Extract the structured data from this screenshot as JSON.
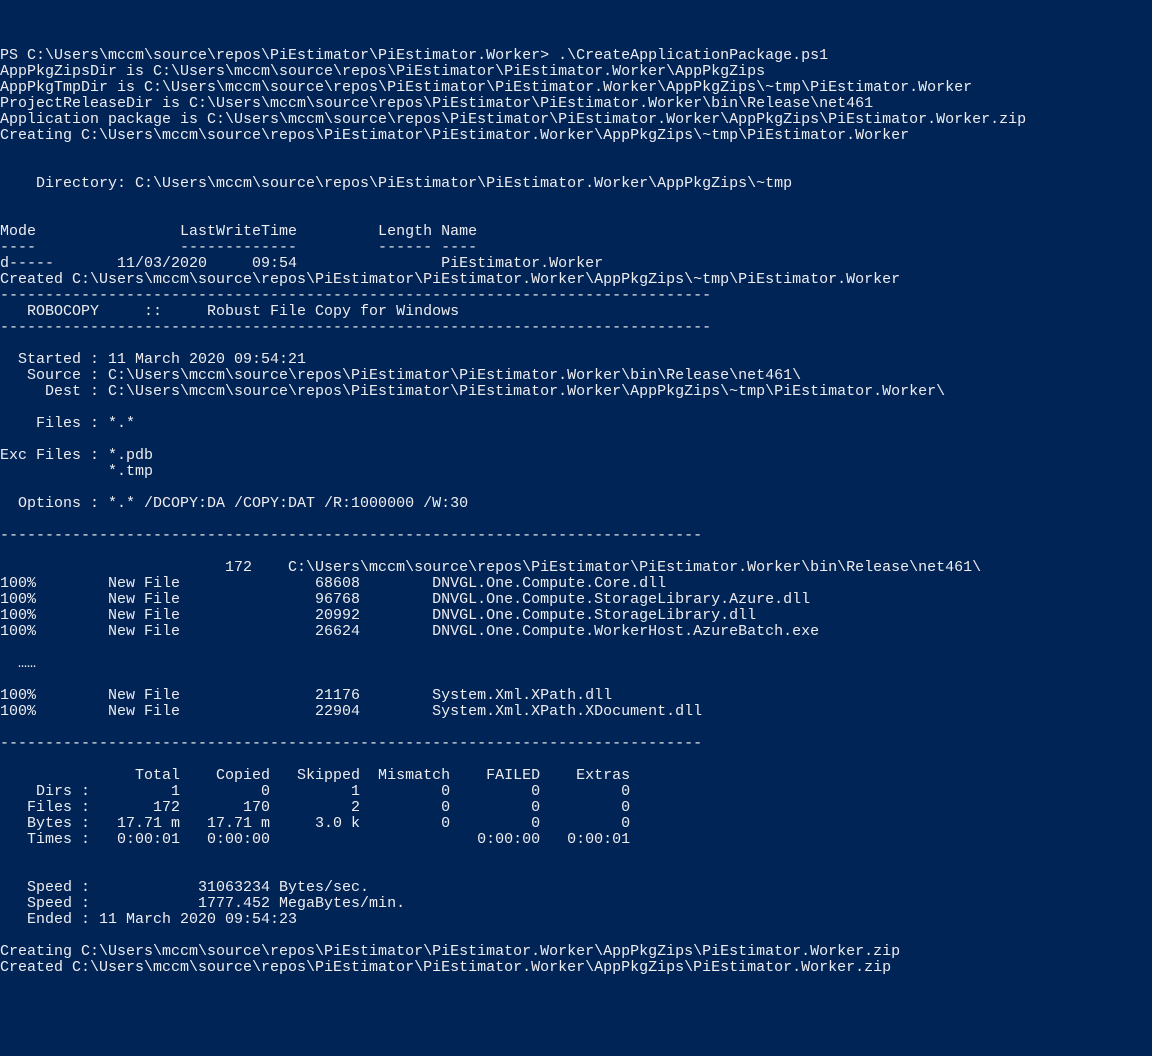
{
  "prompt": "PS C:\\Users\\mccm\\source\\repos\\PiEstimator\\PiEstimator.Worker> .\\CreateApplicationPackage.ps1",
  "vars": {
    "zipsDir": "AppPkgZipsDir is C:\\Users\\mccm\\source\\repos\\PiEstimator\\PiEstimator.Worker\\AppPkgZips",
    "tmpDir": "AppPkgTmpDir is C:\\Users\\mccm\\source\\repos\\PiEstimator\\PiEstimator.Worker\\AppPkgZips\\~tmp\\PiEstimator.Worker",
    "releaseDir": "ProjectReleaseDir is C:\\Users\\mccm\\source\\repos\\PiEstimator\\PiEstimator.Worker\\bin\\Release\\net461",
    "pkg": "Application package is C:\\Users\\mccm\\source\\repos\\PiEstimator\\PiEstimator.Worker\\AppPkgZips\\PiEstimator.Worker.zip"
  },
  "creating1": "Creating C:\\Users\\mccm\\source\\repos\\PiEstimator\\PiEstimator.Worker\\AppPkgZips\\~tmp\\PiEstimator.Worker",
  "dirHeader": "    Directory: C:\\Users\\mccm\\source\\repos\\PiEstimator\\PiEstimator.Worker\\AppPkgZips\\~tmp",
  "tableHeader": "Mode                LastWriteTime         Length Name",
  "tableDashes": "----                -------------         ------ ----",
  "tableRow": "d-----       11/03/2020     09:54                PiEstimator.Worker",
  "created1": "Created C:\\Users\\mccm\\source\\repos\\PiEstimator\\PiEstimator.Worker\\AppPkgZips\\~tmp\\PiEstimator.Worker",
  "sep": "-------------------------------------------------------------------------------",
  "robocopyTitle": "   ROBOCOPY     ::     Robust File Copy for Windows",
  "robocopy": {
    "started": "  Started : 11 March 2020 09:54:21",
    "source": "   Source : C:\\Users\\mccm\\source\\repos\\PiEstimator\\PiEstimator.Worker\\bin\\Release\\net461\\",
    "dest": "     Dest : C:\\Users\\mccm\\source\\repos\\PiEstimator\\PiEstimator.Worker\\AppPkgZips\\~tmp\\PiEstimator.Worker\\",
    "files": "    Files : *.*",
    "exc1": "Exc Files : *.pdb",
    "exc2": "            *.tmp",
    "options": "  Options : *.* /DCOPY:DA /COPY:DAT /R:1000000 /W:30"
  },
  "sep2": "------------------------------------------------------------------------------",
  "copyDirLine": "                         172    C:\\Users\\mccm\\source\\repos\\PiEstimator\\PiEstimator.Worker\\bin\\Release\\net461\\",
  "files": [
    "100%        New File               68608        DNVGL.One.Compute.Core.dll",
    "100%        New File               96768        DNVGL.One.Compute.StorageLibrary.Azure.dll",
    "100%        New File               20992        DNVGL.One.Compute.StorageLibrary.dll",
    "100%        New File               26624        DNVGL.One.Compute.WorkerHost.AzureBatch.exe"
  ],
  "ellipsis": "  ……",
  "files2": [
    "100%        New File               21176        System.Xml.XPath.dll",
    "100%        New File               22904        System.Xml.XPath.XDocument.dll"
  ],
  "stats": {
    "header": "               Total    Copied   Skipped  Mismatch    FAILED    Extras",
    "dirs": "    Dirs :         1         0         1         0         0         0",
    "filesr": "   Files :       172       170         2         0         0         0",
    "bytes": "   Bytes :   17.71 m   17.71 m     3.0 k         0         0         0",
    "times": "   Times :   0:00:01   0:00:00                       0:00:00   0:00:01"
  },
  "speed1": "   Speed :            31063234 Bytes/sec.",
  "speed2": "   Speed :            1777.452 MegaBytes/min.",
  "ended": "   Ended : 11 March 2020 09:54:23",
  "creating2": "Creating C:\\Users\\mccm\\source\\repos\\PiEstimator\\PiEstimator.Worker\\AppPkgZips\\PiEstimator.Worker.zip",
  "created2": "Created C:\\Users\\mccm\\source\\repos\\PiEstimator\\PiEstimator.Worker\\AppPkgZips\\PiEstimator.Worker.zip"
}
